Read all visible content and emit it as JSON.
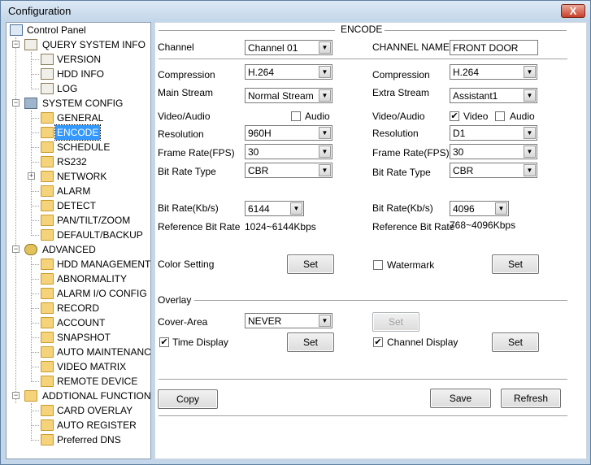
{
  "window": {
    "title": "Configuration",
    "close_label": "X"
  },
  "tree": {
    "root": "Control Panel",
    "query": {
      "label": "QUERY SYSTEM INFO",
      "items": [
        "VERSION",
        "HDD INFO",
        "LOG"
      ]
    },
    "system": {
      "label": "SYSTEM CONFIG",
      "items": [
        "GENERAL",
        "ENCODE",
        "SCHEDULE",
        "RS232",
        "NETWORK",
        "ALARM",
        "DETECT",
        "PAN/TILT/ZOOM",
        "DEFAULT/BACKUP"
      ]
    },
    "advanced": {
      "label": "ADVANCED",
      "items": [
        "HDD MANAGEMENT",
        "ABNORMALITY",
        "ALARM I/O CONFIG",
        "RECORD",
        "ACCOUNT",
        "SNAPSHOT",
        "AUTO MAINTENANCE",
        "VIDEO MATRIX",
        "REMOTE DEVICE"
      ]
    },
    "additional": {
      "label": "ADDTIONAL FUNCTION",
      "items": [
        "CARD OVERLAY",
        "AUTO REGISTER",
        "Preferred DNS"
      ]
    }
  },
  "encode": {
    "section_title": "ENCODE",
    "channel_label": "Channel",
    "channel_value": "Channel 01",
    "channel_name_label": "CHANNEL NAME",
    "channel_name_value": "FRONT DOOR",
    "main": {
      "compression_label": "Compression",
      "compression": "H.264",
      "stream_label": "Main Stream",
      "stream": "Normal Stream",
      "va_label": "Video/Audio",
      "audio_label": "Audio",
      "audio_checked": false,
      "resolution_label": "Resolution",
      "resolution": "960H",
      "fps_label": "Frame Rate(FPS)",
      "fps": "30",
      "brt_label": "Bit Rate Type",
      "brt": "CBR",
      "bitrate_label": "Bit Rate(Kb/s)",
      "bitrate": "6144",
      "ref_label": "Reference Bit Rate",
      "ref": "1024~6144Kbps"
    },
    "extra": {
      "compression_label": "Compression",
      "compression": "H.264",
      "stream_label": "Extra Stream",
      "stream": "Assistant1",
      "va_label": "Video/Audio",
      "video_label": "Video",
      "video_checked": true,
      "audio_label": "Audio",
      "audio_checked": false,
      "resolution_label": "Resolution",
      "resolution": "D1",
      "fps_label": "Frame Rate(FPS)",
      "fps": "30",
      "brt_label": "Bit Rate Type",
      "brt": "CBR",
      "bitrate_label": "Bit Rate(Kb/s)",
      "bitrate": "4096",
      "ref_label": "Reference Bit Rate",
      "ref": "768~4096Kbps"
    },
    "color_setting_label": "Color Setting",
    "watermark_label": "Watermark",
    "watermark_checked": false,
    "overlay_label": "Overlay",
    "cover_area_label": "Cover-Area",
    "cover_area": "NEVER",
    "time_display_label": "Time Display",
    "time_display_checked": true,
    "channel_display_label": "Channel Display",
    "channel_display_checked": true,
    "set_label": "Set",
    "copy_label": "Copy",
    "save_label": "Save",
    "refresh_label": "Refresh"
  }
}
